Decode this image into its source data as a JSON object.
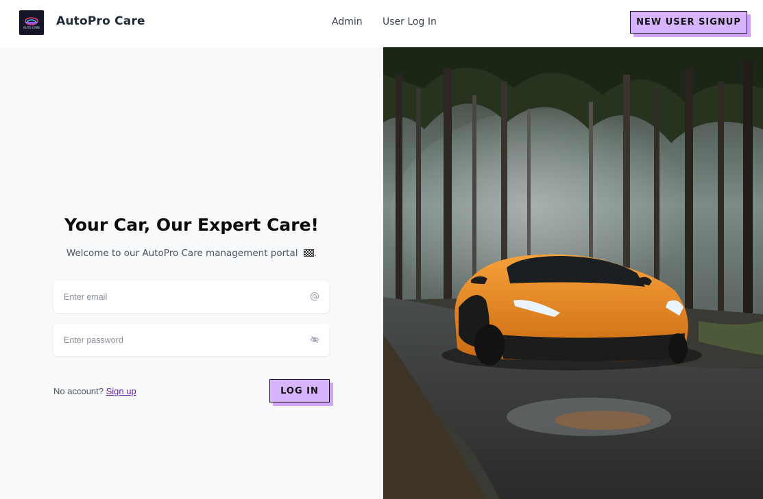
{
  "header": {
    "brand": "AutoPro Care",
    "logo_text": "AUTO CARE",
    "nav": [
      {
        "label": "Admin"
      },
      {
        "label": "User Log In"
      }
    ],
    "signup_button": "NEW USER SIGNUP"
  },
  "login": {
    "title": "Your Car, Our Expert Care!",
    "subtitle": "Welcome to our AutoPro Care management portal",
    "subtitle_end": ".",
    "email_placeholder": "Enter email",
    "password_placeholder": "Enter password",
    "no_account": "No account?",
    "signup_link": "Sign up",
    "login_button": "LOG IN"
  },
  "icons": {
    "email": "at-icon",
    "password": "eye-off-icon",
    "flag": "checkered-flag-icon"
  },
  "colors": {
    "accent": "#d8b4fe",
    "link": "#6b21a8",
    "panel_bg": "#f8f9fb",
    "car": "#f28c1e"
  }
}
